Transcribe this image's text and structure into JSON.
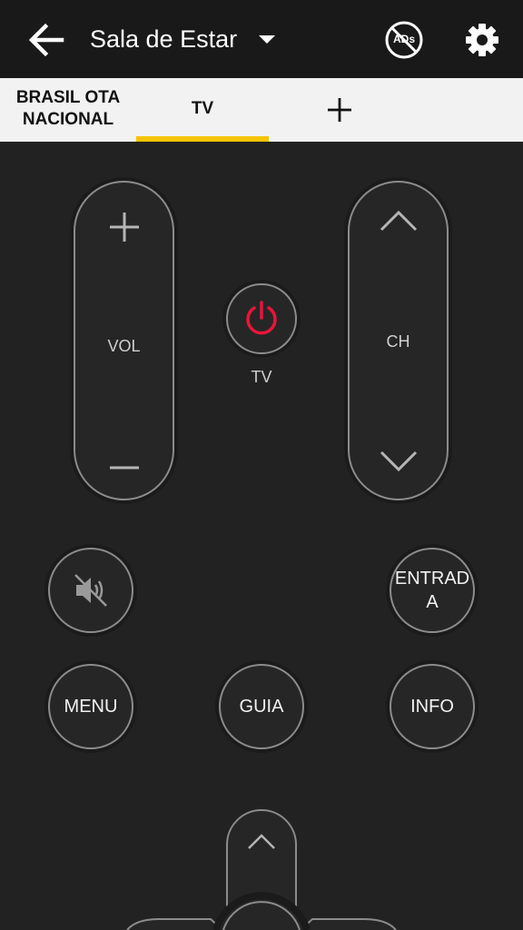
{
  "header": {
    "room_name": "Sala de Estar",
    "ads_badge": "ADs",
    "icons": {
      "back": "arrow-left-icon",
      "dropdown": "caret-down-icon",
      "no_ads": "no-ads-icon",
      "settings": "gear-icon"
    }
  },
  "tabs": {
    "items": [
      {
        "label": "BRASIL OTA NACIONAL"
      },
      {
        "label": "TV"
      }
    ],
    "active_index": 1,
    "add_icon": "plus-icon",
    "underline_color": "#f5c400"
  },
  "remote": {
    "volume_label": "VOL",
    "channel_label": "CH",
    "power_caption": "TV",
    "power_color": "#e8163a",
    "input_label": "ENTRADA",
    "menu_label": "MENU",
    "guide_label": "GUIA",
    "info_label": "INFO",
    "icons": {
      "vol_up": "plus-icon",
      "vol_down": "minus-icon",
      "ch_up": "chevron-up-icon",
      "ch_down": "chevron-down-icon",
      "power": "power-icon",
      "mute": "mute-icon",
      "dpad_up": "chevron-up-icon"
    }
  }
}
